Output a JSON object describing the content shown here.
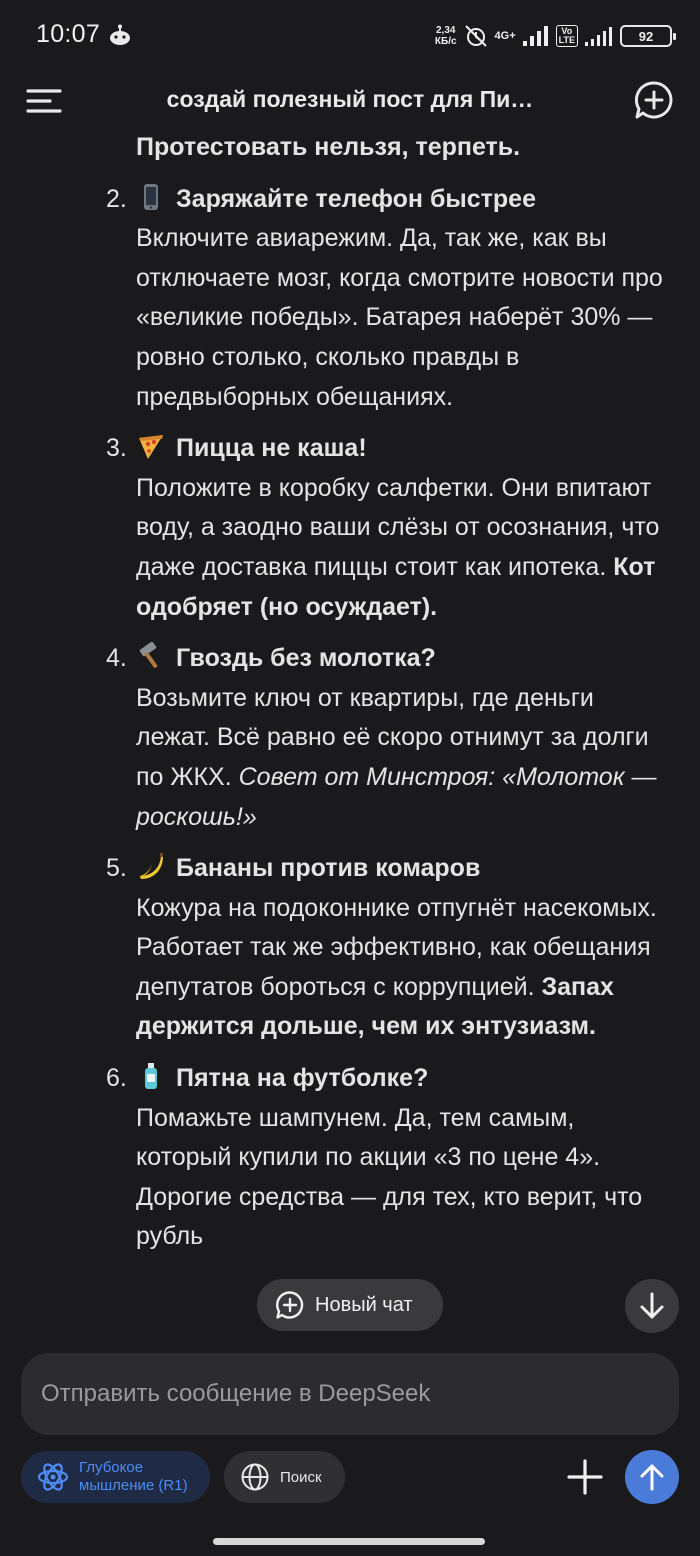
{
  "status_bar": {
    "time": "10:07",
    "speed_top": "2,34",
    "speed_bottom": "КБ/с",
    "network": "4G+",
    "volte_top": "Vo",
    "volte_bottom": "LTE",
    "battery": "92"
  },
  "header": {
    "title": "создай полезный пост для Пи…"
  },
  "message": {
    "lead": "Протестовать нельзя, терпеть.",
    "items": [
      {
        "num": "2.",
        "icon": "phone-icon",
        "head": "Заряжайте телефон быстрее",
        "body": "Включите авиарежим. Да, так же, как вы отключаете мозг, когда смотрите новости про «великие победы». Батарея наберёт 30% — ровно столько, сколько правды в предвыборных обещаниях.",
        "bold_tail": "",
        "italic_tail": ""
      },
      {
        "num": "3.",
        "icon": "pizza-icon",
        "head": "Пицца не каша!",
        "body": "Положите в коробку салфетки. Они впитают воду, а заодно ваши слёзы от осознания, что даже доставка пиццы стоит как ипотека.",
        "bold_tail": "Кот одобряет (но осуждает).",
        "italic_tail": ""
      },
      {
        "num": "4.",
        "icon": "hammer-icon",
        "head": "Гвоздь без молотка?",
        "body": "Возьмите ключ от квартиры, где деньги лежат. Всё равно её скоро отнимут за долги по ЖКХ.",
        "bold_tail": "",
        "italic_tail": "Совет от Минстроя: «Молоток — роскошь!»"
      },
      {
        "num": "5.",
        "icon": "banana-icon",
        "head": "Бананы против комаров",
        "body": "Кожура на подоконнике отпугнёт насекомых. Работает так же эффективно, как обещания депутатов бороться с коррупцией.",
        "bold_tail": "Запах держится дольше, чем их энтузиазм.",
        "italic_tail": ""
      },
      {
        "num": "6.",
        "icon": "lotion-bottle-icon",
        "head": "Пятна на футболке?",
        "body": "Помажьте шампунем. Да, тем самым, который купили по акции «3 по цене 4». Дорогие средства — для тех, кто верит, что рубль",
        "bold_tail": "",
        "italic_tail": ""
      }
    ]
  },
  "floating": {
    "new_chat_label": "Новый чат"
  },
  "composer": {
    "placeholder": "Отправить сообщение в DeepSeek",
    "deep_think_label": "Глубокое мышление (R1)",
    "search_label": "Поиск"
  },
  "colors": {
    "background": "#1a1a1c",
    "accent_blue": "#4d8bf5",
    "send_button": "#4a7bd8"
  }
}
